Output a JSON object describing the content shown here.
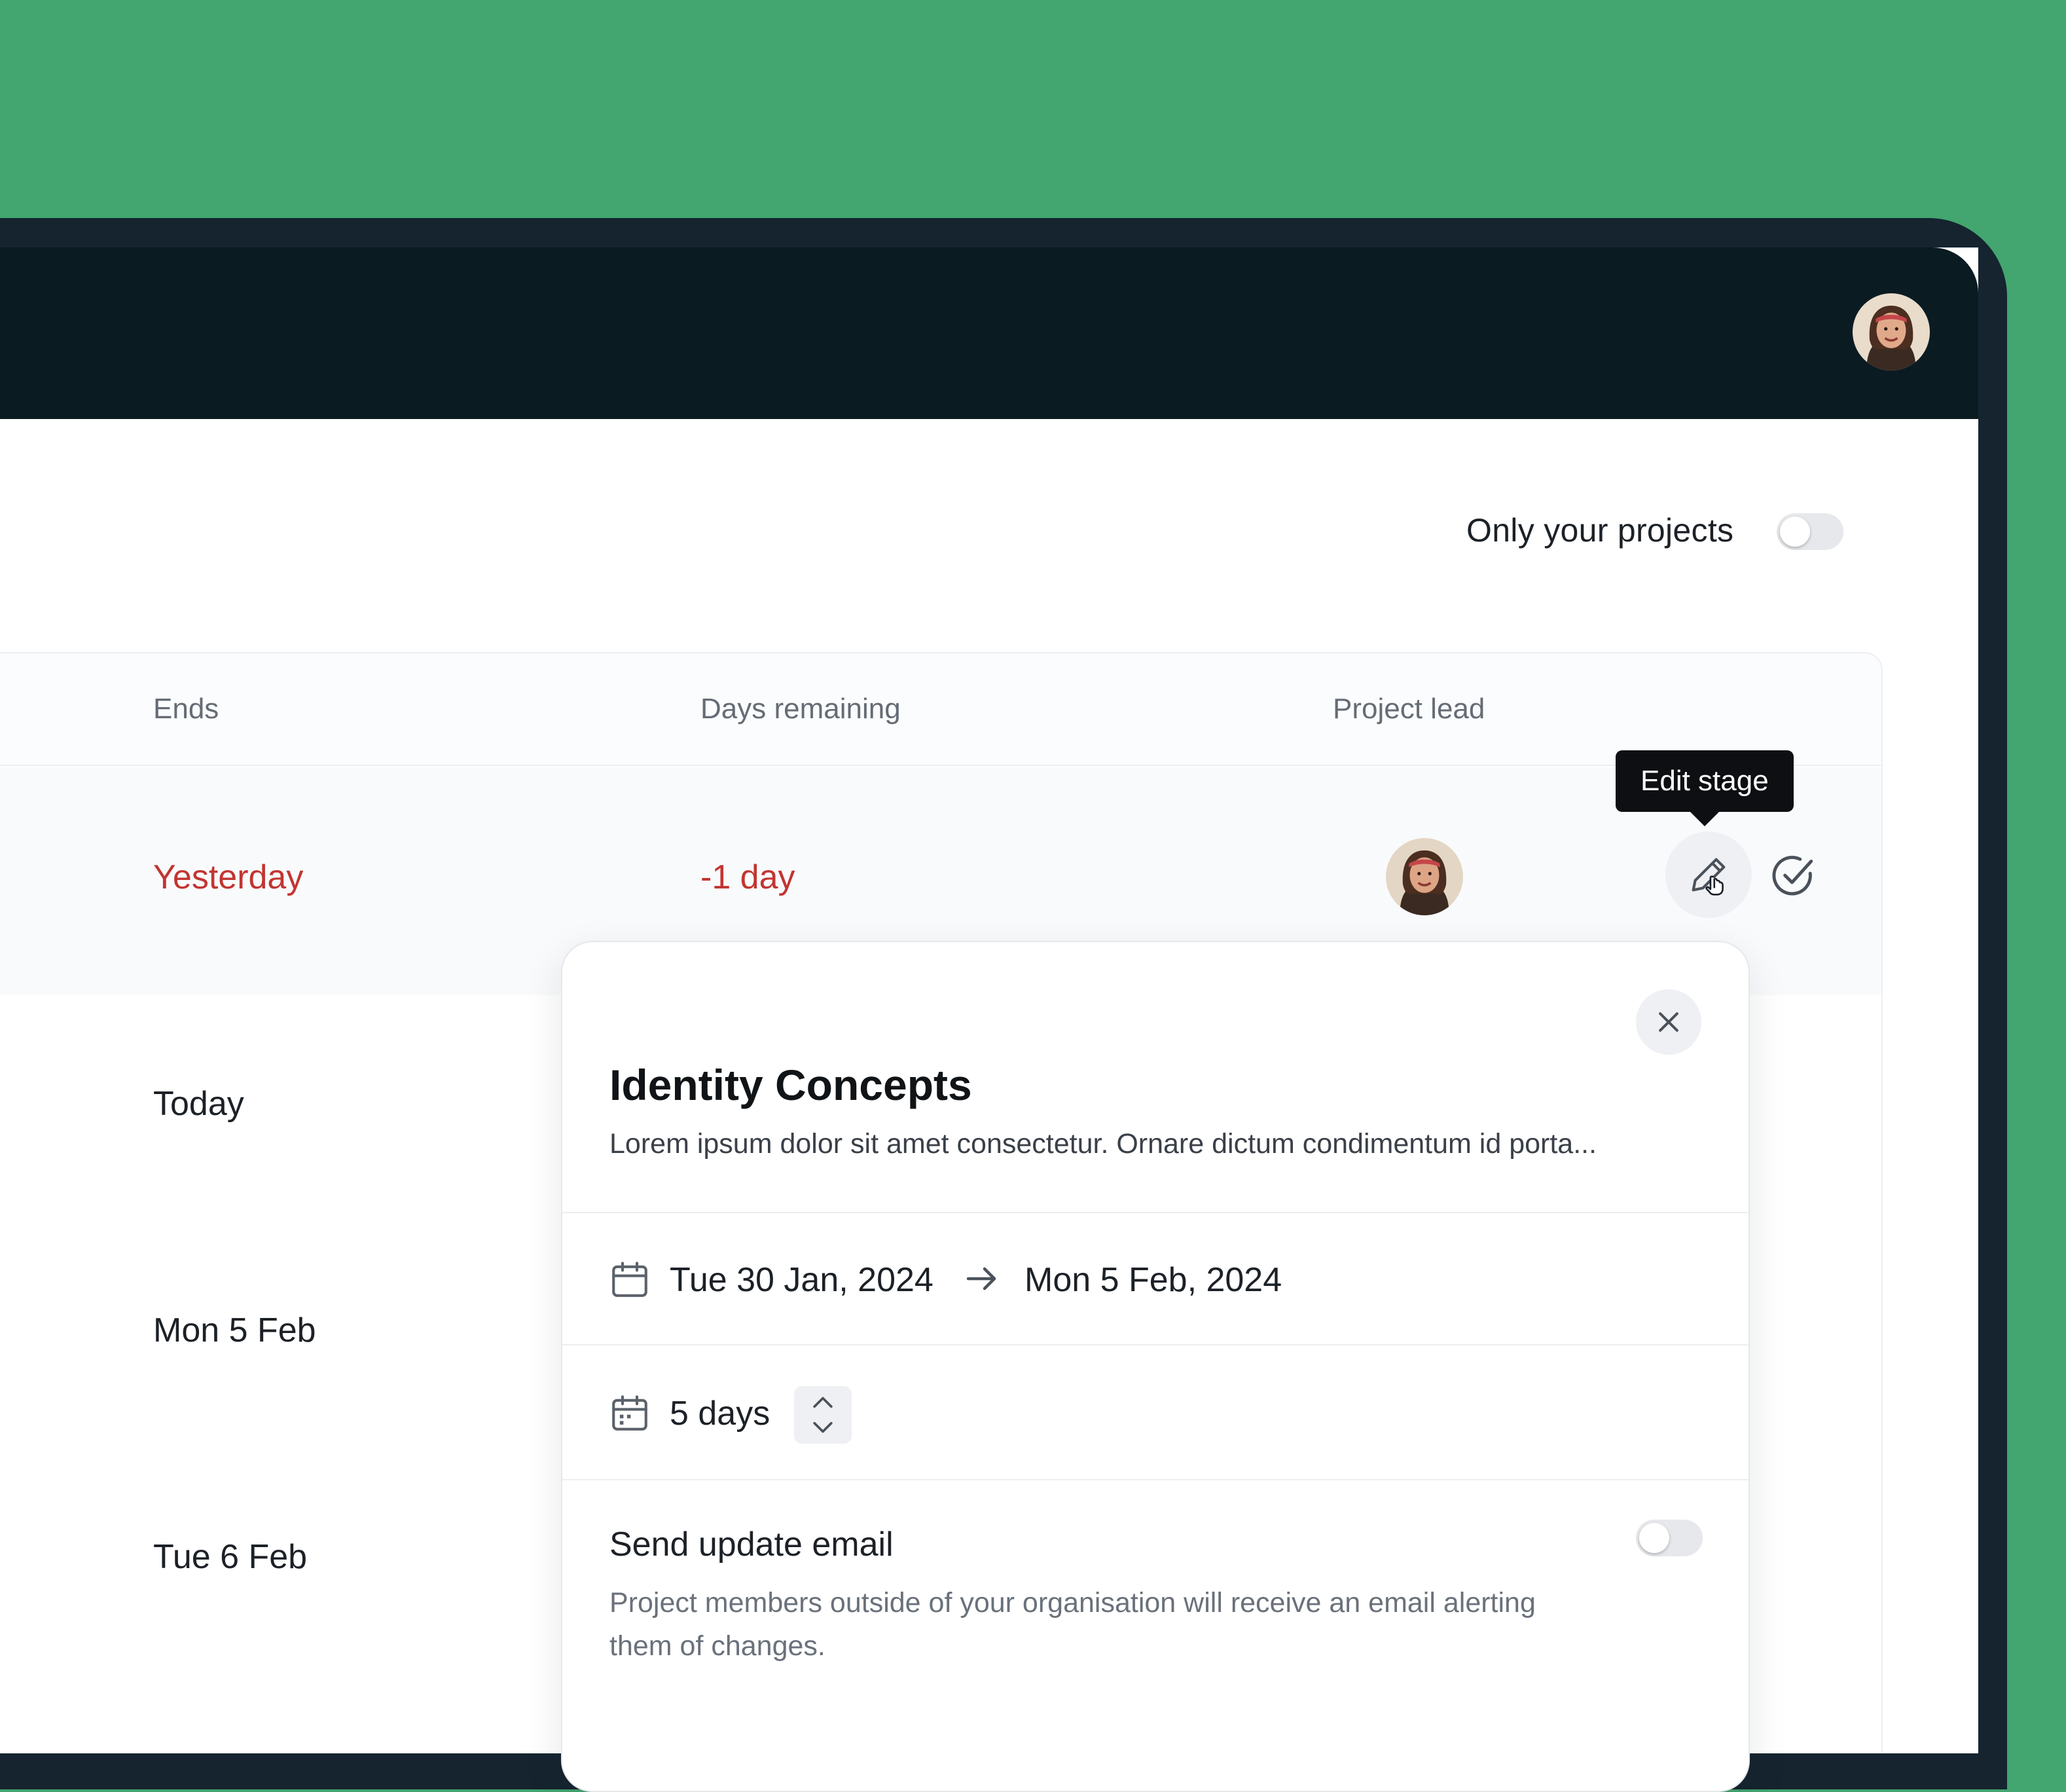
{
  "filters": {
    "only_your_projects_label": "Only your projects",
    "only_your_projects_enabled": false
  },
  "table": {
    "columns": [
      "Ends",
      "Days remaining",
      "Project lead"
    ],
    "rows": [
      {
        "ends": "Yesterday",
        "days_remaining": "-1 day",
        "overdue": true
      },
      {
        "ends": "Today"
      },
      {
        "ends": "Mon 5 Feb"
      },
      {
        "ends": "Tue 6 Feb"
      }
    ]
  },
  "tooltip": {
    "text": "Edit stage"
  },
  "popover": {
    "title": "Identity Concepts",
    "description": "Lorem ipsum dolor sit amet consectetur. Ornare dictum condimentum id porta...",
    "start_date": "Tue 30 Jan, 2024",
    "end_date": "Mon 5 Feb, 2024",
    "duration": "5 days",
    "email": {
      "title": "Send update email",
      "description": "Project members outside of your organisation will receive an email alerting them of changes.",
      "enabled": false
    }
  },
  "icons": {
    "user_avatar": "avatar-icon",
    "edit": "pencil-icon",
    "complete": "check-circle-icon",
    "close": "close-icon",
    "calendar": "calendar-icon",
    "arrow": "arrow-right-icon",
    "stepper_up": "chevron-up-icon",
    "stepper_down": "chevron-down-icon"
  },
  "colors": {
    "background": "#43a56f",
    "topbar": "#0a1b22",
    "overdue": "#c23531",
    "tooltip": "#0d0f12"
  }
}
